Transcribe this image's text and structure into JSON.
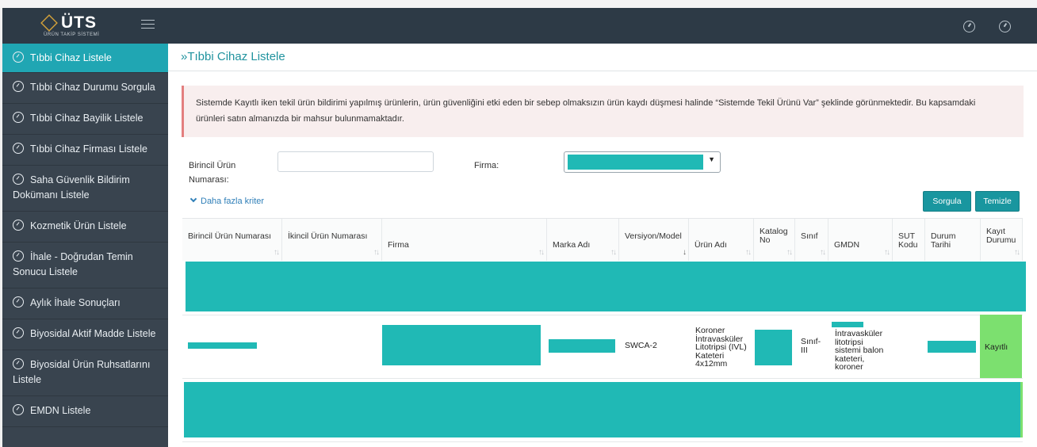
{
  "brand": {
    "name": "ÜTS",
    "subtitle": "ÜRÜN TAKİP SİSTEMİ"
  },
  "sidebar": {
    "items": [
      {
        "label": "Tıbbi Cihaz Listele",
        "active": true
      },
      {
        "label": "Tıbbi Cihaz Durumu Sorgula"
      },
      {
        "label": "Tıbbi Cihaz Bayilik Listele"
      },
      {
        "label": "Tıbbi Cihaz Firması Listele"
      },
      {
        "label": "Saha Güvenlik Bildirim Dokümanı Listele"
      },
      {
        "label": "Kozmetik Ürün Listele"
      },
      {
        "label": "İhale - Doğrudan Temin Sonucu Listele"
      },
      {
        "label": "Aylık İhale Sonuçları"
      },
      {
        "label": "Biyosidal Aktif Madde Listele"
      },
      {
        "label": "Biyosidal Ürün Ruhsatlarını Listele"
      },
      {
        "label": "EMDN Listele"
      }
    ]
  },
  "page": {
    "title": "»Tıbbi Cihaz Listele"
  },
  "alert": {
    "text": "Sistemde Kayıtlı iken tekil ürün bildirimi yapılmış ürünlerin, ürün güvenliğini etki eden bir sebep olmaksızın ürün kaydı düşmesi halinde “Sistemde Tekil Ürünü Var” şeklinde görünmektedir. Bu kapsamdaki ürünleri satın almanızda bir mahsur bulunmamaktadır."
  },
  "filters": {
    "primary_label": "Birincil Ürün Numarası:",
    "primary_value": "",
    "company_label": "Firma:",
    "more_label": "Daha fazla kriter",
    "query_button": "Sorgula",
    "clear_button": "Temizle"
  },
  "table": {
    "columns": [
      "Birincil Ürün Numarası",
      "İkincil Ürün Numarası",
      "Firma",
      "Marka Adı",
      "Versiyon/Model",
      "Ürün Adı",
      "Katalog No",
      "Sınıf",
      "GMDN",
      "SUT Kodu",
      "Durum Tarihi",
      "Kayıt Durumu"
    ],
    "row": {
      "model": "SWCA-2",
      "product": "Koroner İntravasküler Litotripsi (IVL) Kateteri 4x12mm",
      "class": "Sınıf-III",
      "gmdn": "İntravasküler litotripsi sistemi balon kateteri, koroner",
      "status": "Kayıtlı"
    }
  },
  "colors": {
    "topbar": "#2d3a46",
    "sidebar": "#39444f",
    "accent": "#20a6b3",
    "redaction": "#20b9b5",
    "status_green": "#7ce06f"
  }
}
